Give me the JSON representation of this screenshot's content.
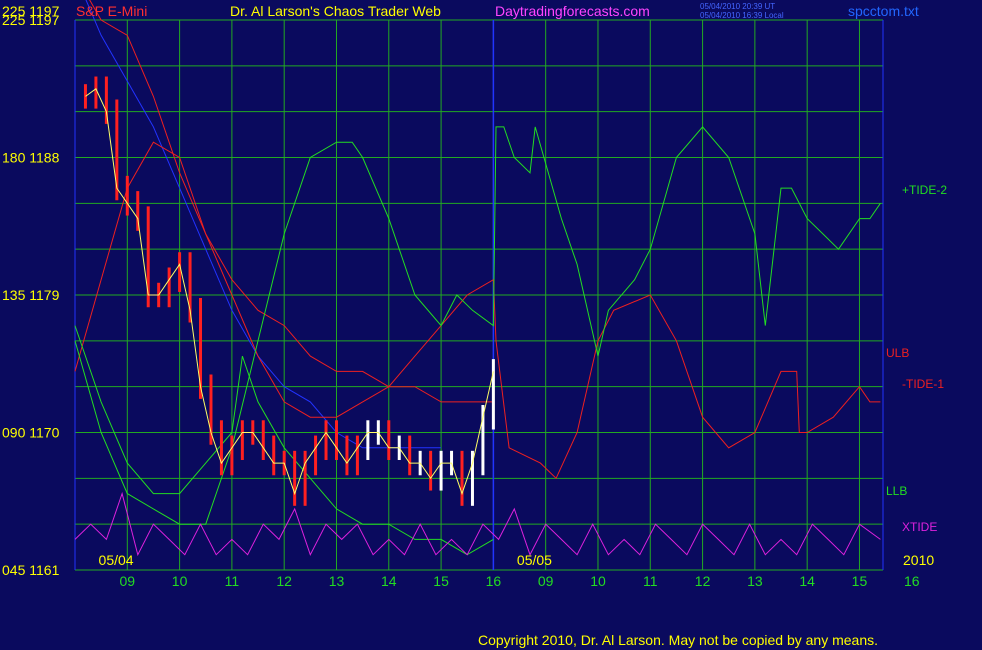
{
  "header": {
    "left_axis_top": "225 1197",
    "instrument": "S&P E-Mini",
    "site_title": "Dr. Al Larson's Chaos Trader Web",
    "site_url": "Daytradingforecasts.com",
    "timestamp_1": "05/04/2010 20:39 UT",
    "timestamp_2": "05/04/2010 16:39 Local",
    "file_name": "spcctom.txt"
  },
  "footer": {
    "copyright": "Copyright 2010, Dr. Al Larson. May not be copied by any means."
  },
  "colors": {
    "background": "#0a0a5e",
    "grid": "#22aa22",
    "axis_label": "#ffff00",
    "hour_label": "#22dd22",
    "price_bar_down": "#ff2020",
    "price_bar_up": "#ffffff",
    "tide2": "#22dd22",
    "tide1": "#ee2020",
    "ulb": "#ee2020",
    "llb": "#22dd22",
    "xtide": "#dd22dd",
    "blue_line": "#2233ff",
    "yellow_line": "#ffff66"
  },
  "chart_data": {
    "type": "line",
    "title": "S&P E-Mini",
    "y_left_labels": [
      "225 1197",
      "180 1188",
      "135 1179",
      "090 1170",
      "045 1161"
    ],
    "y_price_range": [
      1161,
      1197
    ],
    "x_hour_labels": [
      "09",
      "10",
      "11",
      "12",
      "13",
      "14",
      "15",
      "16",
      "09",
      "10",
      "11",
      "12",
      "13",
      "14",
      "15",
      "16"
    ],
    "date_labels": [
      "05/04",
      "05/05",
      "2010"
    ],
    "legend": [
      {
        "name": "+TIDE-2",
        "color": "#22dd22"
      },
      {
        "name": "ULB",
        "color": "#ee2020"
      },
      {
        "name": "-TIDE-1",
        "color": "#ee2020"
      },
      {
        "name": "LLB",
        "color": "#22dd22"
      },
      {
        "name": "XTIDE",
        "color": "#dd22dd"
      }
    ],
    "price_bars": {
      "description": "intraday bars 05/04 08:30 to 16:00",
      "hours": [
        8.2,
        8.4,
        8.6,
        8.8,
        9.0,
        9.2,
        9.4,
        9.6,
        9.8,
        10.0,
        10.2,
        10.4,
        10.6,
        10.8,
        11.0,
        11.2,
        11.4,
        11.6,
        11.8,
        12.0,
        12.2,
        12.4,
        12.6,
        12.8,
        13.0,
        13.2,
        13.4,
        13.6,
        13.8,
        14.0,
        14.2,
        14.4,
        14.6,
        14.8,
        15.0,
        15.2,
        15.4,
        15.6,
        15.8,
        16.0
      ],
      "close": [
        1192,
        1192.5,
        1191,
        1186,
        1185,
        1184,
        1179,
        1179,
        1180,
        1181,
        1178,
        1173,
        1170,
        1168,
        1169,
        1170,
        1170,
        1169,
        1168,
        1168,
        1166,
        1168,
        1169,
        1170,
        1169,
        1168,
        1169,
        1170,
        1170,
        1169,
        1169,
        1168,
        1168,
        1167,
        1168,
        1168,
        1166,
        1168,
        1171,
        1174
      ]
    },
    "series": [
      {
        "name": "+TIDE-2",
        "x": [
          8.0,
          8.5,
          9.0,
          9.5,
          10.0,
          10.5,
          11.0,
          11.5,
          12.0,
          12.5,
          13.0,
          13.3,
          13.5,
          14.0,
          14.5,
          15.0,
          15.3,
          15.6,
          16.0,
          16.05,
          16.2,
          16.4,
          16.7,
          16.8,
          17.3,
          17.6,
          18.0,
          18.2,
          18.7,
          19.0,
          19.5,
          20.0,
          20.5,
          21.0,
          21.2,
          21.5,
          21.7,
          22.0,
          22.3,
          22.6,
          23.0,
          23.2,
          23.4
        ],
        "y": [
          1176,
          1170,
          1166,
          1165,
          1164,
          1164,
          1169,
          1176,
          1183,
          1188,
          1189,
          1189,
          1188,
          1184,
          1179,
          1177,
          1179,
          1178,
          1177,
          1190,
          1190,
          1188,
          1187,
          1190,
          1184,
          1181,
          1175,
          1178,
          1180,
          1182,
          1188,
          1190,
          1188,
          1183,
          1177,
          1186,
          1186,
          1184,
          1183,
          1182,
          1184,
          1184,
          1185
        ]
      },
      {
        "name": "ULB",
        "x": [
          8.0,
          8.5,
          9.0,
          9.5,
          10.0,
          10.5,
          11.0,
          11.5,
          12.0,
          12.5,
          13.0,
          13.5,
          14.0,
          14.5,
          15.0,
          15.5,
          16.0
        ],
        "y": [
          1200,
          1197,
          1196,
          1192,
          1187,
          1183,
          1180,
          1178,
          1177,
          1175,
          1174,
          1174,
          1173,
          1173,
          1172,
          1172,
          1172
        ]
      },
      {
        "name": "-TIDE-1",
        "x": [
          8.0,
          8.5,
          9.0,
          9.5,
          10.0,
          10.5,
          11.0,
          11.5,
          12.0,
          12.5,
          13.0,
          13.5,
          14.0,
          14.5,
          15.0,
          15.5,
          16.0,
          16.05,
          16.3,
          16.9,
          17.2,
          17.6,
          18.0,
          18.3,
          19.0,
          19.5,
          20.0,
          20.5,
          21.0,
          21.5,
          21.8,
          21.85,
          22.0,
          22.5,
          23.0,
          23.2,
          23.4
        ],
        "y": [
          1174,
          1180,
          1186,
          1189,
          1188,
          1183,
          1179,
          1175,
          1172,
          1171,
          1171,
          1172,
          1173,
          1175,
          1177,
          1179,
          1180,
          1176,
          1169,
          1168,
          1167,
          1170,
          1176,
          1178,
          1179,
          1176,
          1171,
          1169,
          1170,
          1174,
          1174,
          1170,
          1170,
          1171,
          1173,
          1172,
          1172
        ]
      },
      {
        "name": "LLB",
        "x": [
          8.0,
          8.5,
          9.0,
          9.5,
          10.0,
          10.5,
          11.0,
          11.2,
          11.5,
          12.0,
          12.5,
          13.0,
          13.5,
          14.0,
          14.5,
          15.0,
          15.5,
          16.0
        ],
        "y": [
          1177,
          1172,
          1168,
          1166,
          1166,
          1168,
          1170,
          1175,
          1172,
          1169,
          1167,
          1165,
          1164,
          1164,
          1163,
          1163,
          1162,
          1163
        ]
      },
      {
        "name": "XTIDE",
        "x": [
          8.0,
          8.3,
          8.6,
          8.9,
          9.2,
          9.5,
          9.8,
          10.1,
          10.4,
          10.7,
          11.0,
          11.3,
          11.6,
          11.9,
          12.2,
          12.5,
          12.8,
          13.1,
          13.4,
          13.7,
          14.0,
          14.3,
          14.6,
          14.9,
          15.2,
          15.5,
          15.8,
          16.1,
          16.4,
          16.7,
          17.0,
          17.3,
          17.6,
          17.9,
          18.2,
          18.5,
          18.8,
          19.1,
          19.4,
          19.7,
          20.0,
          20.3,
          20.6,
          20.9,
          21.2,
          21.5,
          21.8,
          22.1,
          22.4,
          22.7,
          23.0,
          23.4
        ],
        "y": [
          1163,
          1164,
          1163,
          1166,
          1162,
          1164,
          1163,
          1162,
          1164,
          1162,
          1163,
          1162,
          1164,
          1163,
          1165,
          1162,
          1164,
          1163,
          1164,
          1162,
          1163,
          1162,
          1164,
          1162,
          1163,
          1162,
          1164,
          1163,
          1165,
          1162,
          1164,
          1163,
          1162,
          1164,
          1162,
          1163,
          1162,
          1164,
          1163,
          1162,
          1164,
          1163,
          1162,
          1164,
          1162,
          1163,
          1162,
          1164,
          1163,
          1162,
          1164,
          1163
        ]
      },
      {
        "name": "blue",
        "x": [
          8.0,
          8.5,
          9.0,
          9.5,
          10.0,
          10.5,
          11.0,
          11.5,
          12.0,
          12.5,
          13.0,
          13.5,
          14.0,
          14.5,
          15.0
        ],
        "y": [
          1200,
          1196,
          1193,
          1190,
          1186,
          1182,
          1178,
          1175,
          1173,
          1172,
          1170,
          1169,
          1169,
          1169,
          1169
        ]
      }
    ]
  }
}
